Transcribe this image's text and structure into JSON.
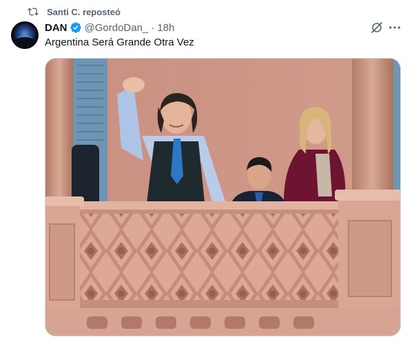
{
  "repost": {
    "icon": "repost-icon",
    "text": "Santi C. reposteó"
  },
  "tweet": {
    "author": {
      "display_name": "DAN",
      "handle": "@GordoDan_",
      "verified": true,
      "avatar_icon": "avatar-image"
    },
    "separator": "·",
    "time": "18h",
    "text": "Argentina Será Grande Otra Vez",
    "media": {
      "type": "photo"
    }
  },
  "colors": {
    "verified_blue": "#1d9bf0",
    "secondary_text": "#536471",
    "primary_text": "#0f1419",
    "border": "#cfd9de"
  }
}
